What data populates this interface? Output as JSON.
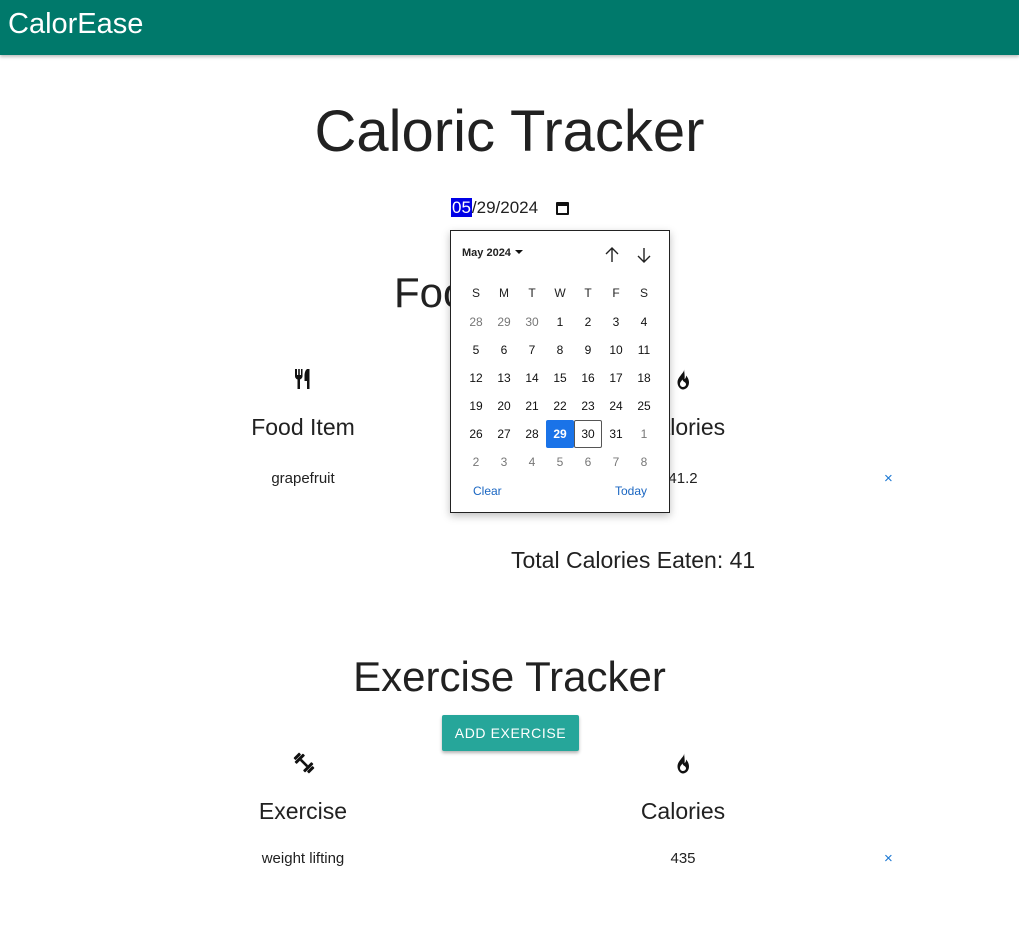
{
  "app": {
    "title": "CalorEase"
  },
  "page": {
    "title": "Caloric Tracker"
  },
  "date_input": {
    "month": "05",
    "rest": "/29/2024",
    "icon": "calendar-icon"
  },
  "calendar": {
    "month_label": "May 2024",
    "weekdays": [
      "S",
      "M",
      "T",
      "W",
      "T",
      "F",
      "S"
    ],
    "weeks": [
      [
        "28",
        "29",
        "30",
        "1",
        "2",
        "3",
        "4"
      ],
      [
        "5",
        "6",
        "7",
        "8",
        "9",
        "10",
        "11"
      ],
      [
        "12",
        "13",
        "14",
        "15",
        "16",
        "17",
        "18"
      ],
      [
        "19",
        "20",
        "21",
        "22",
        "23",
        "24",
        "25"
      ],
      [
        "26",
        "27",
        "28",
        "29",
        "30",
        "31",
        "1"
      ],
      [
        "2",
        "3",
        "4",
        "5",
        "6",
        "7",
        "8"
      ]
    ],
    "other_month": [
      [
        0,
        0
      ],
      [
        0,
        1
      ],
      [
        0,
        2
      ],
      [
        4,
        6
      ],
      [
        5,
        0
      ],
      [
        5,
        1
      ],
      [
        5,
        2
      ],
      [
        5,
        3
      ],
      [
        5,
        4
      ],
      [
        5,
        5
      ],
      [
        5,
        6
      ]
    ],
    "selected": [
      4,
      3
    ],
    "focused": [
      4,
      4
    ],
    "clear_label": "Clear",
    "today_label": "Today",
    "selected_color": "#1a73e8"
  },
  "food": {
    "title": "Food",
    "columns": [
      {
        "icon": "utensils-icon",
        "label": "Food Item"
      },
      {
        "icon": "fire-icon",
        "label": "Calories"
      }
    ],
    "rows": [
      {
        "item": "grapefruit",
        "calories": "41.2",
        "delete": "×"
      }
    ],
    "total_label": "Total Calories Eaten: 41"
  },
  "exercise": {
    "title": "Exercise Tracker",
    "add_label": "Add Exercise",
    "columns": [
      {
        "icon": "dumbbell-icon",
        "label": "Exercise"
      },
      {
        "icon": "fire-icon",
        "label": "Calories"
      }
    ],
    "rows": [
      {
        "item": "weight lifting",
        "calories": "435",
        "delete": "×"
      }
    ]
  },
  "colors": {
    "appbar": "#00796b",
    "button": "#26a69a",
    "link": "#1976d2"
  }
}
